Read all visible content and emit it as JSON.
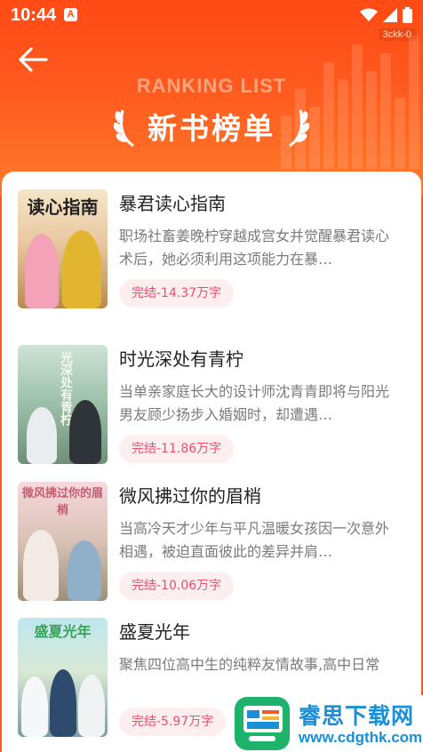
{
  "status_bar": {
    "time": "10:44",
    "app_icon_letter": "A",
    "tag": "3ckk-0"
  },
  "header": {
    "ranking_label": "RANKING LIST",
    "title": "新书榜单"
  },
  "books": [
    {
      "cover_text": "读心指南",
      "title": "暴君读心指南",
      "desc": "职场社畜姜晚柠穿越成宫女并觉醒暴君读心术后，她必须利用这项能力在暴…",
      "badge": "完结-14.37万字"
    },
    {
      "cover_text": "光深处有青柠",
      "title": "时光深处有青柠",
      "desc": "当单亲家庭长大的设计师沈青青即将与阳光男友顾少扬步入婚姻时，却遭遇…",
      "badge": "完结-11.86万字"
    },
    {
      "cover_text": "微风拂过你的眉梢",
      "title": "微风拂过你的眉梢",
      "desc": "当高冷天才少年与平凡温暖女孩因一次意外相遇，被迫直面彼此的差异并肩…",
      "badge": "完结-10.06万字"
    },
    {
      "cover_text": "盛夏光年",
      "title": "盛夏光年",
      "desc": "聚焦四位高中生的纯粹友情故事,高中日常",
      "badge": "完结-5.97万字"
    }
  ],
  "watermark": {
    "name": "睿思下载网",
    "url": "www.cdgthk.com"
  },
  "colors": {
    "header_orange": "#ff5a1f",
    "badge_pink": "#ef4e6c",
    "badge_bg": "#fdeef0",
    "watermark_blue": "#1a8fd8"
  }
}
